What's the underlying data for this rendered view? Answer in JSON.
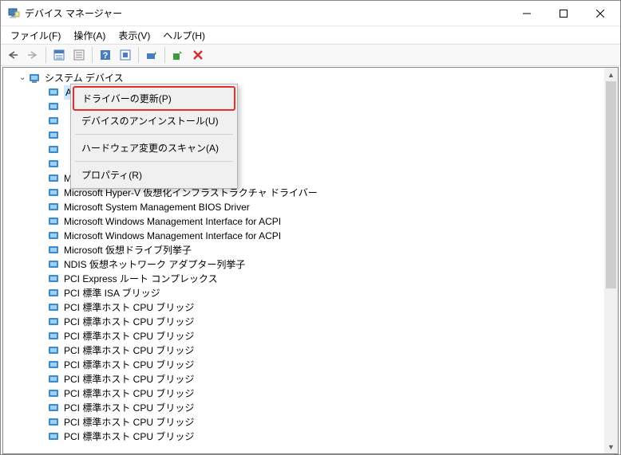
{
  "window": {
    "title": "デバイス マネージャー"
  },
  "menubar": {
    "file": "ファイル(F)",
    "action": "操作(A)",
    "view": "表示(V)",
    "help": "ヘルプ(H)"
  },
  "tree": {
    "root_label": "システム デバイス",
    "selected_item": "ACPI Fixed Feature ボタン",
    "items": [
      "Microsoft ACPI-Compliant System",
      "Microsoft Hyper-V 仮想化インフラストラクチャ ドライバー",
      "Microsoft System Management BIOS Driver",
      "Microsoft Windows Management Interface for ACPI",
      "Microsoft Windows Management Interface for ACPI",
      "Microsoft 仮想ドライブ列挙子",
      "NDIS 仮想ネットワーク アダプター列挙子",
      "PCI Express ルート コンプレックス",
      "PCI 標準 ISA ブリッジ",
      "PCI 標準ホスト CPU ブリッジ",
      "PCI 標準ホスト CPU ブリッジ",
      "PCI 標準ホスト CPU ブリッジ",
      "PCI 標準ホスト CPU ブリッジ",
      "PCI 標準ホスト CPU ブリッジ",
      "PCI 標準ホスト CPU ブリッジ",
      "PCI 標準ホスト CPU ブリッジ",
      "PCI 標準ホスト CPU ブリッジ",
      "PCI 標準ホスト CPU ブリッジ",
      "PCI 標準ホスト CPU ブリッジ"
    ]
  },
  "context_menu": {
    "update_driver": "ドライバーの更新(P)",
    "uninstall": "デバイスのアンインストール(U)",
    "scan": "ハードウェア変更のスキャン(A)",
    "properties": "プロパティ(R)"
  }
}
